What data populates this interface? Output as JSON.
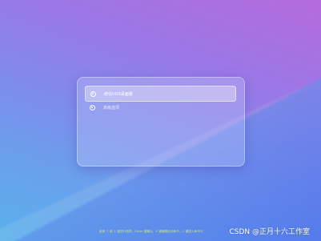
{
  "menu": {
    "items": [
      {
        "label": "统信UOS桌面版",
        "selected": true
      },
      {
        "label": "高级选项",
        "selected": false
      }
    ]
  },
  "help_text": "使用 ↑ 和 ↓ 键进行选择，Enter 键确认，E 键编辑启动命令，C 键进入命令行",
  "watermark": "CSDN @正月十六工作室",
  "colors": {
    "help_text": "#cfe87a",
    "selection": "rgba(255,255,255,0.35)"
  },
  "icons": {
    "menu_item": "radio-icon"
  }
}
